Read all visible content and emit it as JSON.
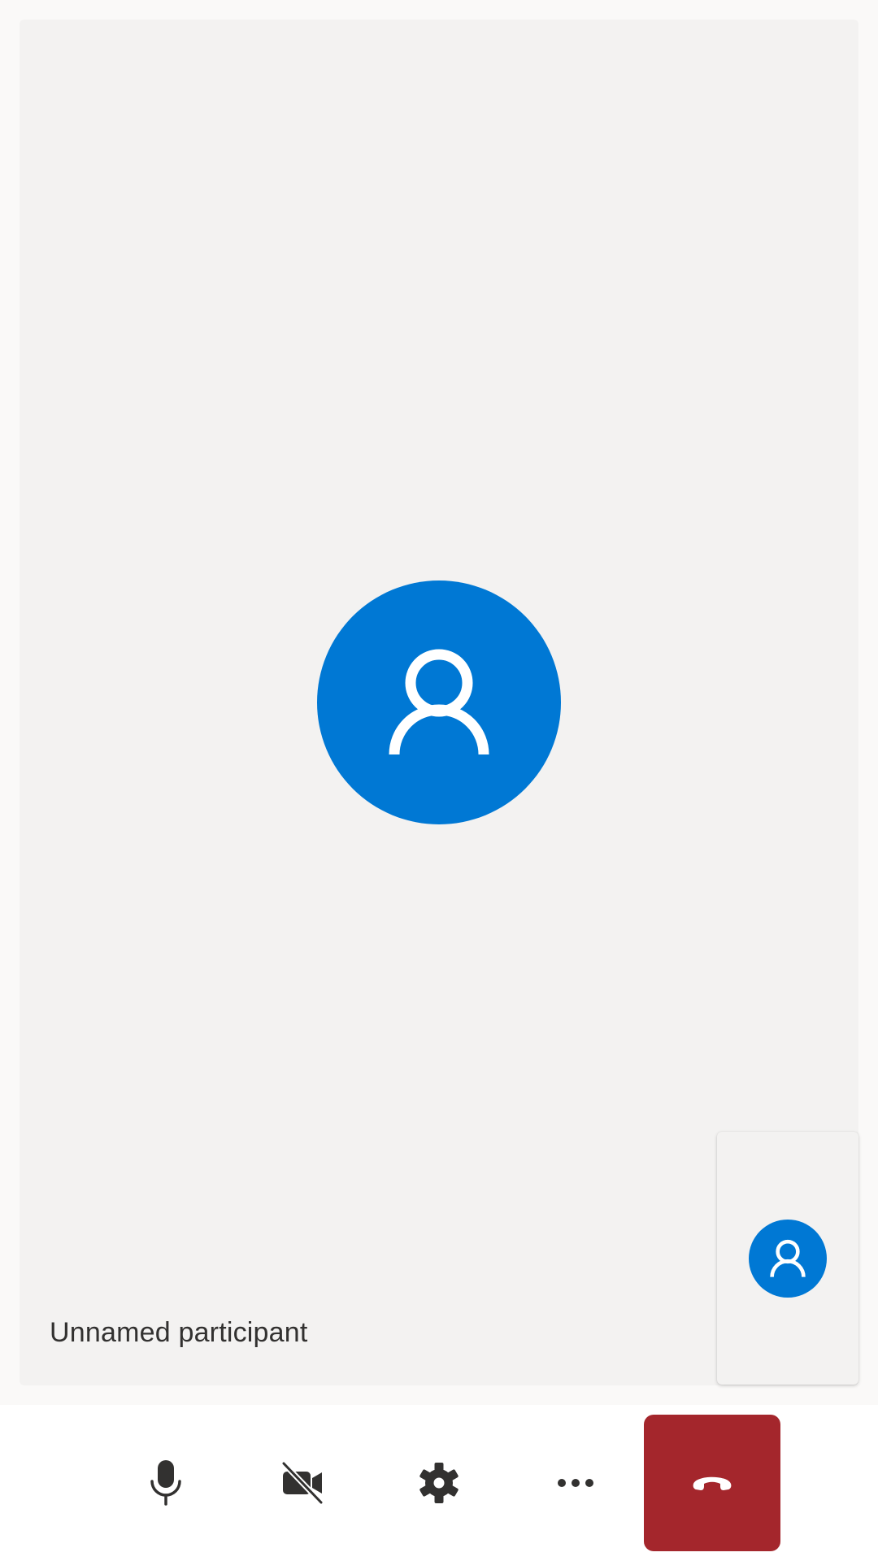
{
  "main_tile": {
    "participant_name": "Unnamed participant",
    "avatar_icon": "person-icon",
    "avatar_color": "#0078d4"
  },
  "self_view": {
    "avatar_icon": "person-icon",
    "avatar_color": "#0078d4"
  },
  "controls": {
    "microphone": {
      "icon": "microphone-icon"
    },
    "camera": {
      "icon": "camera-off-icon"
    },
    "settings": {
      "icon": "gear-icon"
    },
    "more": {
      "icon": "more-horizontal-icon"
    },
    "hang_up": {
      "icon": "phone-hangup-icon",
      "color": "#a4262c"
    }
  }
}
